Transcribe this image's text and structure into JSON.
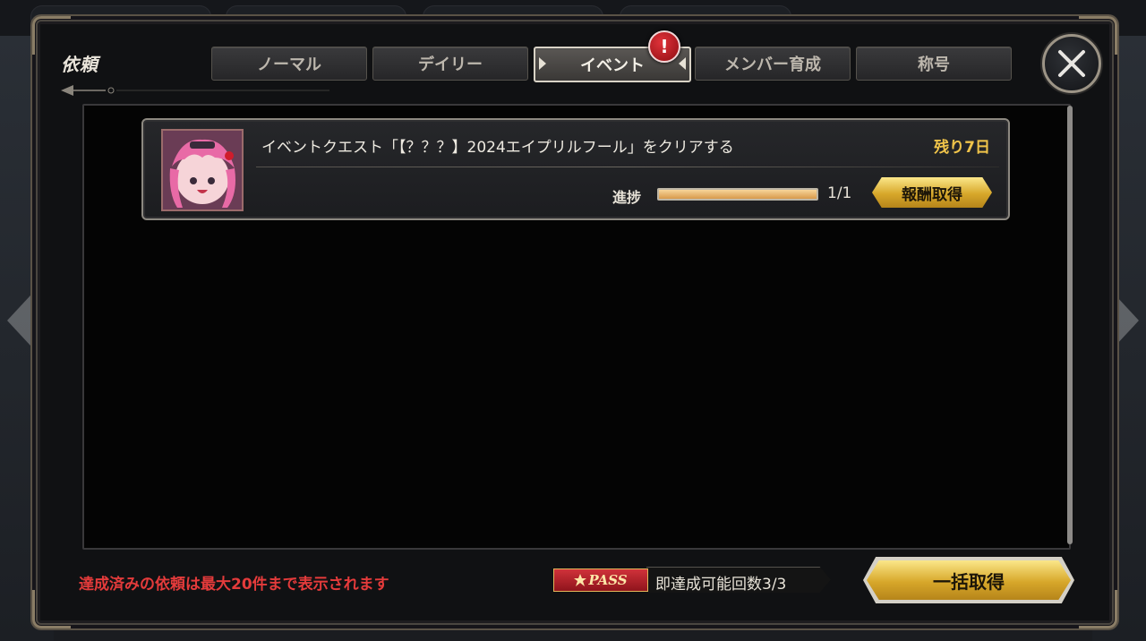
{
  "modal": {
    "title": "依頼",
    "tabs": [
      {
        "label": "ノーマル",
        "active": false
      },
      {
        "label": "デイリー",
        "active": false
      },
      {
        "label": "イベント",
        "active": true
      },
      {
        "label": "メンバー育成",
        "active": false
      },
      {
        "label": "称号",
        "active": false
      }
    ],
    "alert_badge": "!",
    "close_icon": "close-icon"
  },
  "quests": [
    {
      "title": "イベントクエスト「【？？？】2024エイプリルフール」をクリアする",
      "remaining": "残り7日",
      "progress_label": "進捗",
      "progress_text": "1/1",
      "progress_fraction": 1.0,
      "reward_button": "報酬取得",
      "thumbnail_icon": "character-portrait-icon"
    }
  ],
  "footer": {
    "note": "達成済みの依頼は最大20件まで表示されます",
    "pass_label": "PASS",
    "pass_count": "即達成可能回数3/3",
    "bulk_button": "一括取得"
  },
  "colors": {
    "accent_gold": "#d7a72a",
    "alert_red": "#c4161e",
    "remaining_text": "#f0c44a",
    "warning_text": "#e43b3b"
  }
}
